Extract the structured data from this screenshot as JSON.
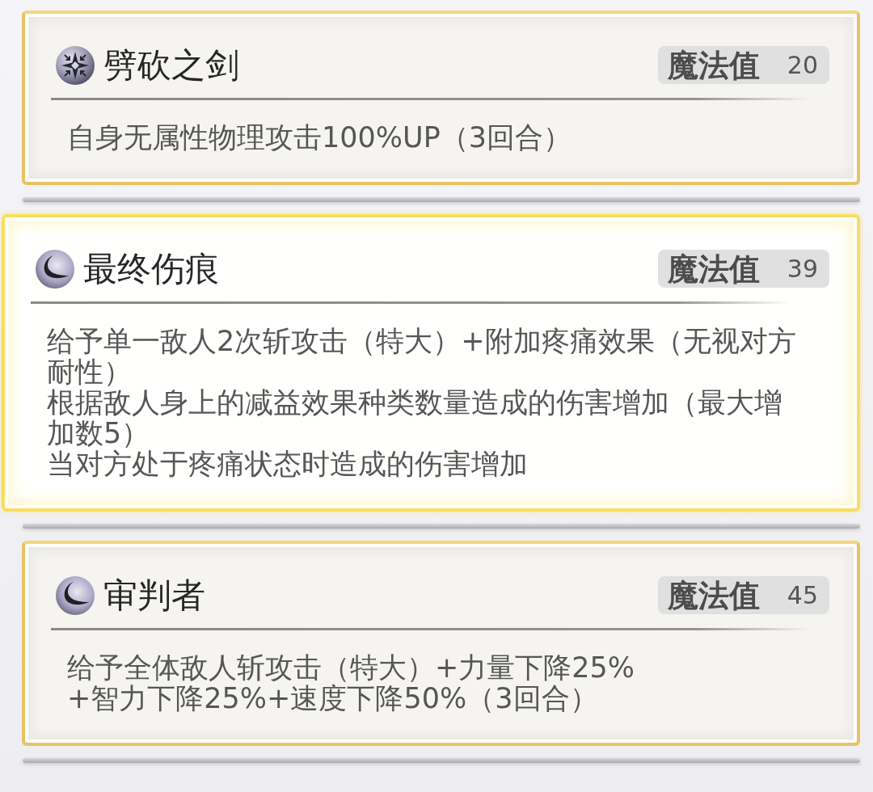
{
  "skills": [
    {
      "name": "劈砍之剑",
      "kind": "buff",
      "selected": false,
      "cost_label": "魔法值",
      "cost": "20",
      "description": [
        "自身无属性物理攻击100%UP（3回合）"
      ]
    },
    {
      "name": "最终伤痕",
      "kind": "slash",
      "selected": true,
      "cost_label": "魔法值",
      "cost": "39",
      "description": [
        "给予单一敌人2次斩攻击（特大）+附加疼痛效果（无视对方耐性）",
        "根据敌人身上的减益效果种类数量造成的伤害增加（最大增加数5）",
        "当对方处于疼痛状态时造成的伤害增加"
      ]
    },
    {
      "name": "审判者",
      "kind": "slash",
      "selected": false,
      "cost_label": "魔法值",
      "cost": "45",
      "description": [
        "给予全体敌人斩攻击（特大）+力量下降25%",
        "+智力下降25%+速度下降50%（3回合）"
      ]
    }
  ]
}
